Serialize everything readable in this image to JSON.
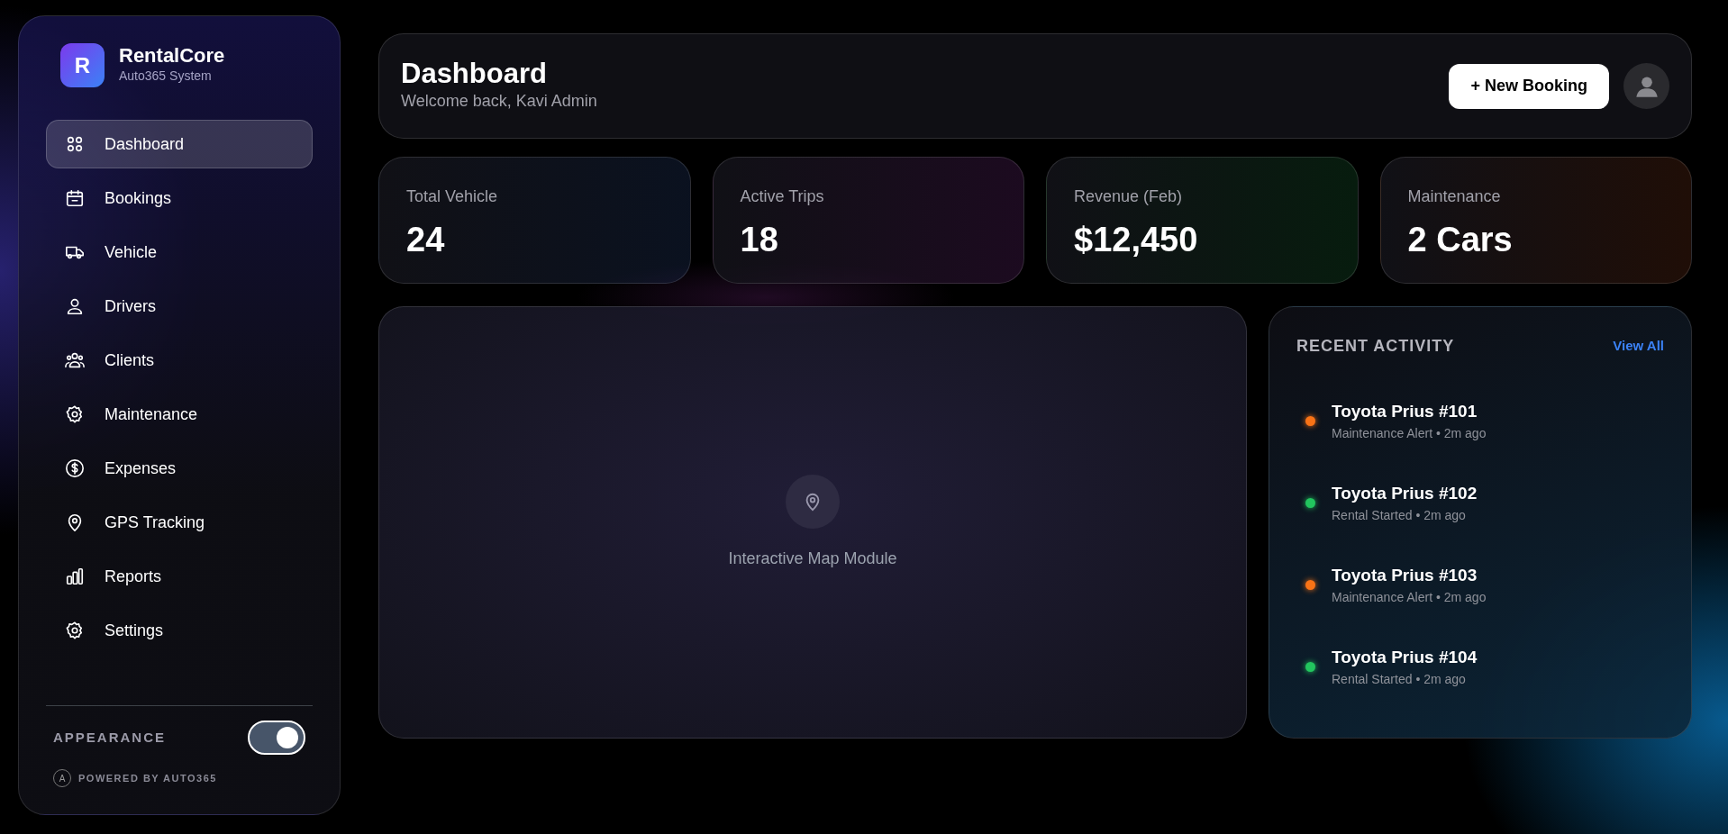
{
  "brand": {
    "logo": "R",
    "name": "RentalCore",
    "subtitle": "Auto365 System"
  },
  "sidebar": {
    "items": [
      {
        "label": "Dashboard",
        "selected": true
      },
      {
        "label": "Bookings",
        "selected": false
      },
      {
        "label": "Vehicle",
        "selected": false
      },
      {
        "label": "Drivers",
        "selected": false
      },
      {
        "label": "Clients",
        "selected": false
      },
      {
        "label": "Maintenance",
        "selected": false
      },
      {
        "label": "Expenses",
        "selected": false
      },
      {
        "label": "GPS Tracking",
        "selected": false
      },
      {
        "label": "Reports",
        "selected": false
      },
      {
        "label": "Settings",
        "selected": false
      }
    ],
    "appearance": {
      "label": "APPEARANCE",
      "on": true
    },
    "footer": {
      "badge": "A",
      "text": "POWERED BY AUTO365"
    }
  },
  "header": {
    "title": "Dashboard",
    "subtitle": "Welcome back, Kavi Admin",
    "button": "+ New Booking"
  },
  "stats": [
    {
      "label": "Total Vehicle",
      "value": "24"
    },
    {
      "label": "Active Trips",
      "value": "18"
    },
    {
      "label": "Revenue (Feb)",
      "value": "$12,450"
    },
    {
      "label": "Maintenance",
      "value": "2 Cars"
    }
  ],
  "map": {
    "label": "Interactive Map Module"
  },
  "activity": {
    "title": "RECENT ACTIVITY",
    "link": "View All",
    "items": [
      {
        "title": "Toyota Prius #101",
        "detail": "Maintenance Alert • 2m ago",
        "color": "#f97316"
      },
      {
        "title": "Toyota Prius #102",
        "detail": "Rental Started • 2m ago",
        "color": "#22c55e"
      },
      {
        "title": "Toyota Prius #103",
        "detail": "Maintenance Alert • 2m ago",
        "color": "#f97316"
      },
      {
        "title": "Toyota Prius #104",
        "detail": "Rental Started • 2m ago",
        "color": "#22c55e"
      }
    ]
  }
}
